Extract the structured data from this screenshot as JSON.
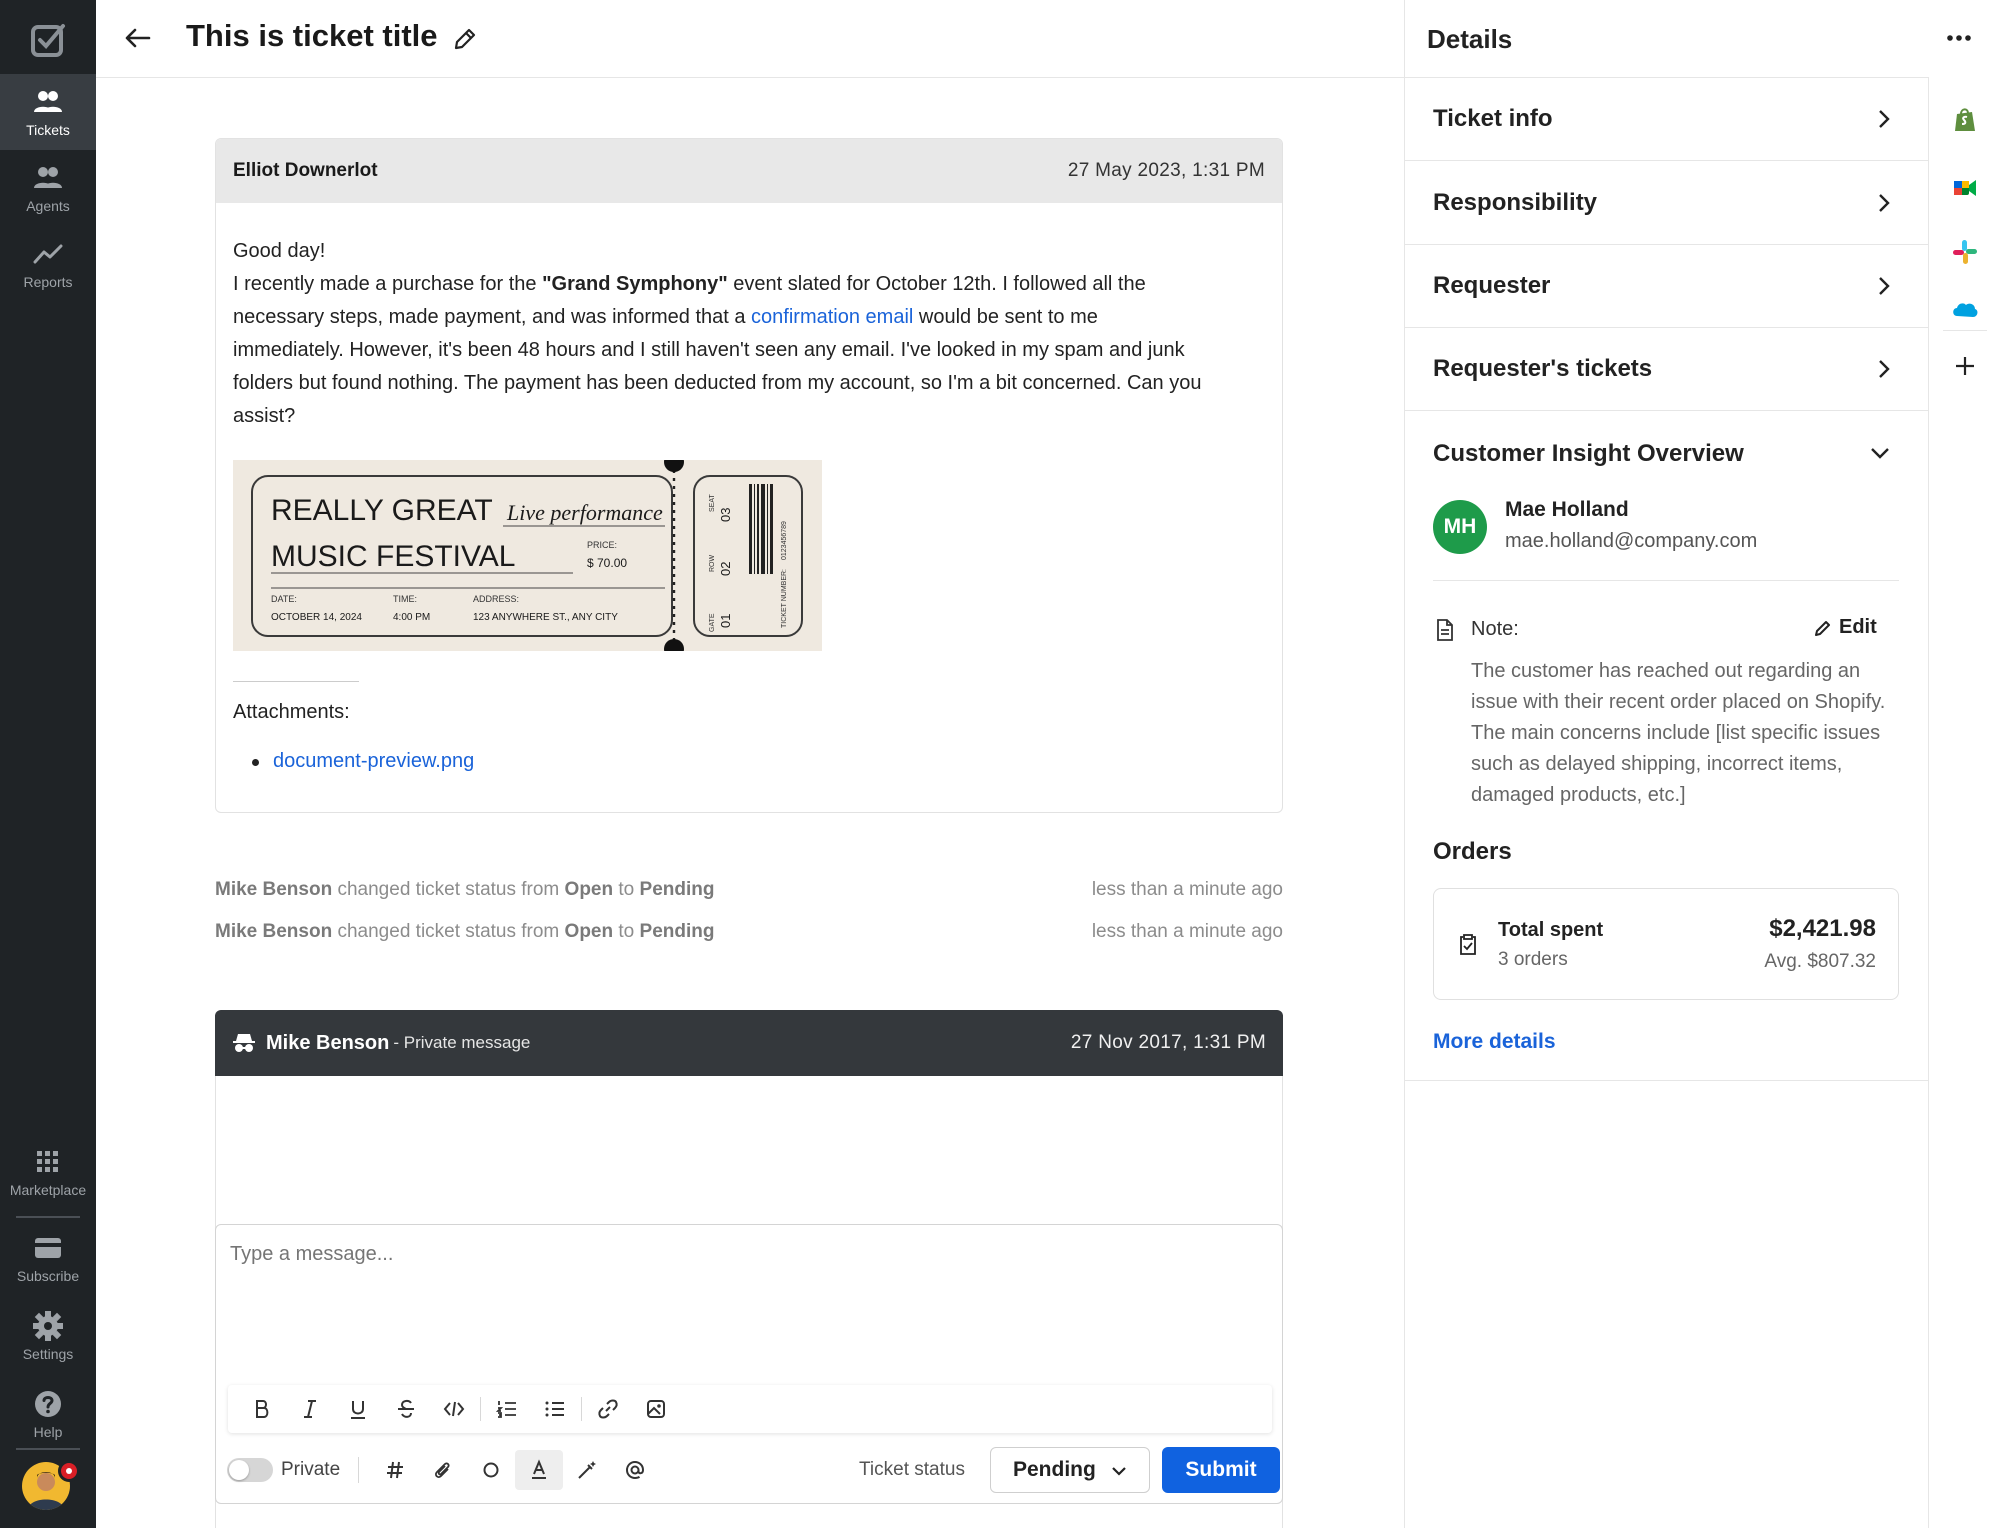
{
  "nav": {
    "items": [
      {
        "label": "Tickets",
        "active": true
      },
      {
        "label": "Agents",
        "active": false
      },
      {
        "label": "Reports",
        "active": false
      }
    ],
    "bottom_items": [
      {
        "label": "Marketplace"
      },
      {
        "label": "Subscribe"
      },
      {
        "label": "Settings"
      },
      {
        "label": "Help"
      }
    ]
  },
  "header": {
    "title": "This is ticket title"
  },
  "message": {
    "author": "Elliot Downerlot",
    "date": "27 May 2023, 1:31 PM",
    "greeting": "Good day!",
    "part1": "I recently made a purchase for the ",
    "event": "\"Grand Symphony\"",
    "part2": " event slated for October 12th. I followed all the necessary steps, made payment, and was informed that a ",
    "link_text": "confirmation email",
    "part3": " would be sent to me immediately. However, it's been 48 hours and I still haven't seen any email. I've looked in my spam and junk folders but found nothing. The payment has been deducted from my account, so I'm a bit concerned. Can you assist?",
    "attachments_label": "Attachments:",
    "attachments": [
      "document-preview.png"
    ]
  },
  "ticket_image": {
    "line1": "REALLY GREAT",
    "script": "Live performance",
    "line2": "MUSIC FESTIVAL",
    "price_label": "PRICE:",
    "price": "$ 70.00",
    "date_label": "DATE:",
    "date": "OCTOBER 14, 2024",
    "time_label": "TIME:",
    "time": "4:00 PM",
    "address_label": "ADDRESS:",
    "address": "123 ANYWHERE ST., ANY CITY",
    "seat_label": "SEAT",
    "seat": "03",
    "row_label": "ROW",
    "row": "02",
    "gate_label": "GATE",
    "gate": "01",
    "ticket_number_label": "TICKET NUMBER:",
    "ticket_number": "0123456789"
  },
  "activity": [
    {
      "actor": "Mike Benson",
      "text": " changed ticket status from ",
      "from": "Open",
      "to_word": " to ",
      "to": "Pending",
      "time": "less than a minute ago"
    },
    {
      "actor": "Mike Benson",
      "text": " changed ticket status from ",
      "from": "Open",
      "to_word": " to ",
      "to": "Pending",
      "time": "less than a minute ago"
    }
  ],
  "private_message": {
    "author": "Mike Benson",
    "type": "- Private message",
    "date": "27 Nov 2017, 1:31 PM"
  },
  "composer": {
    "placeholder": "Type a message...",
    "private_label": "Private",
    "status_label": "Ticket status",
    "status_value": "Pending",
    "submit_label": "Submit"
  },
  "details": {
    "title": "Details",
    "rows": [
      {
        "label": "Ticket info"
      },
      {
        "label": "Responsibility"
      },
      {
        "label": "Requester"
      },
      {
        "label": "Requester's tickets"
      }
    ],
    "insight": {
      "title": "Customer Insight Overview",
      "initials": "MH",
      "name": "Mae Holland",
      "email": "mae.holland@company.com",
      "note_label": "Note:",
      "edit_label": "Edit",
      "note_text": "The customer has reached out regarding an issue with their recent order placed on Shopify. The main concerns include [list specific issues such as delayed shipping, incorrect items, damaged products, etc.]",
      "orders_title": "Orders",
      "total_spent_label": "Total spent",
      "orders_count": "3 orders",
      "total_amount": "$2,421.98",
      "avg": "Avg. $807.32",
      "more_details": "More details"
    }
  },
  "colors": {
    "nav_bg": "#1f2326",
    "accent": "#1062e0",
    "link": "#1a63d9",
    "avatar_green": "#1e9b4a"
  }
}
